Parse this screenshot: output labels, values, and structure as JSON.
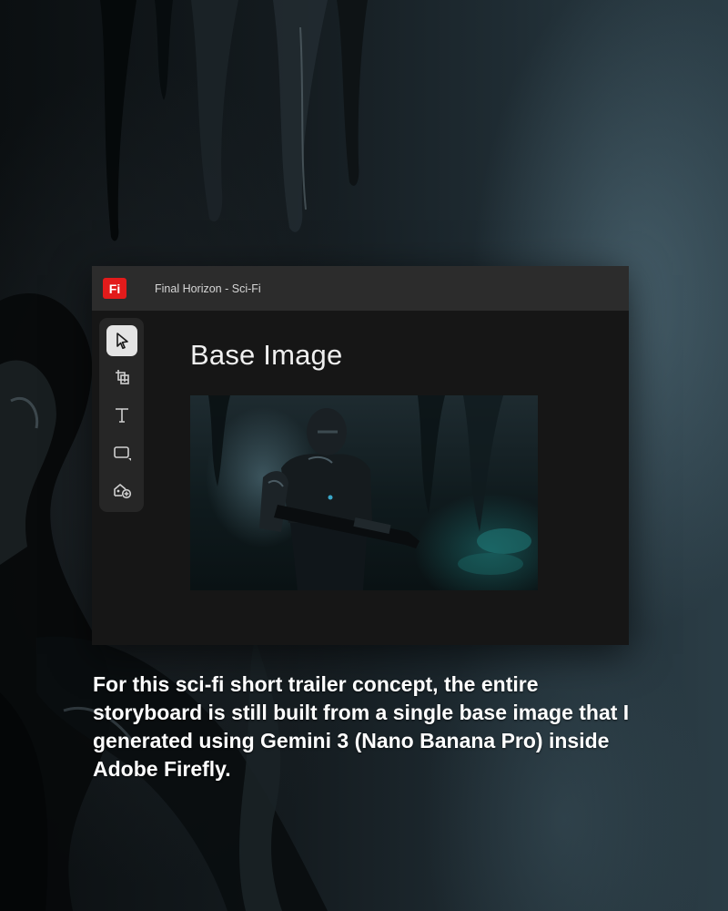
{
  "window": {
    "app_logo_text": "Fi",
    "title": "Final Horizon - Sci-Fi"
  },
  "toolbar": {
    "tools": [
      {
        "icon": "pointer-icon",
        "selected": true
      },
      {
        "icon": "crop-icon",
        "selected": false
      },
      {
        "icon": "text-icon",
        "selected": false
      },
      {
        "icon": "rectangle-shape-icon",
        "selected": false
      },
      {
        "icon": "generate-image-icon",
        "selected": false
      }
    ]
  },
  "canvas": {
    "heading": "Base Image"
  },
  "caption": "For this sci-fi short trailer concept, the entire storyboard is still built from a single base image that I generated using Gemini 3 (Nano Banana Pro) inside Adobe Firefly.",
  "colors": {
    "logo_red": "#e31b1b",
    "title_bar": "#2c2c2c",
    "panel": "#161616",
    "toolbar": "#262626"
  }
}
